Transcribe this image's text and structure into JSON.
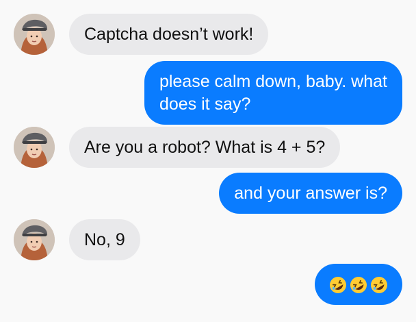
{
  "colors": {
    "incoming_bubble": "#e9e9eb",
    "outgoing_bubble": "#0a7cff",
    "background": "#f9f9f9"
  },
  "messages": [
    {
      "direction": "incoming",
      "text": "Captcha doesn’t work!"
    },
    {
      "direction": "outgoing",
      "line1": "please calm down, baby. what",
      "line2": "does it say?"
    },
    {
      "direction": "incoming",
      "text": "Are you a robot? What is 4 + 5?"
    },
    {
      "direction": "outgoing",
      "text": "and your answer is?"
    },
    {
      "direction": "incoming",
      "text": "No, 9"
    },
    {
      "direction": "outgoing",
      "emoji": [
        "rolling-on-floor-laughing-emoji",
        "rolling-on-floor-laughing-emoji",
        "rolling-on-floor-laughing-emoji"
      ]
    }
  ]
}
